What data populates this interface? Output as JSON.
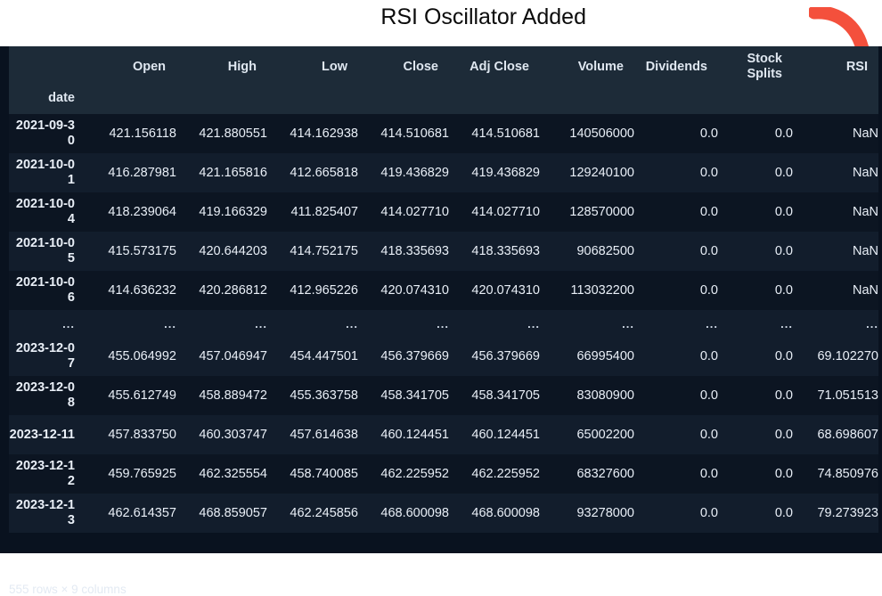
{
  "annotation": {
    "title": "RSI Oscillator Added",
    "arrow_color": "#f44336",
    "arrow_name": "curved-down-arrow"
  },
  "theme": {
    "page_background": "#ffffff",
    "panel_background": "#09121f",
    "header_background": "#1d2b38",
    "row_odd_background": "#0c1522",
    "row_even_background": "#121d2c",
    "text_color": "#e9eff7"
  },
  "table": {
    "index_name": "date",
    "columns": [
      "Open",
      "High",
      "Low",
      "Close",
      "Adj Close",
      "Volume",
      "Dividends",
      "Stock Splits",
      "RSI"
    ],
    "ellipsis": "...",
    "rows": [
      {
        "index": "2021-09-30",
        "cells": [
          "421.156118",
          "421.880551",
          "414.162938",
          "414.510681",
          "414.510681",
          "140506000",
          "0.0",
          "0.0",
          "NaN"
        ]
      },
      {
        "index": "2021-10-01",
        "cells": [
          "416.287981",
          "421.165816",
          "412.665818",
          "419.436829",
          "419.436829",
          "129240100",
          "0.0",
          "0.0",
          "NaN"
        ]
      },
      {
        "index": "2021-10-04",
        "cells": [
          "418.239064",
          "419.166329",
          "411.825407",
          "414.027710",
          "414.027710",
          "128570000",
          "0.0",
          "0.0",
          "NaN"
        ]
      },
      {
        "index": "2021-10-05",
        "cells": [
          "415.573175",
          "420.644203",
          "414.752175",
          "418.335693",
          "418.335693",
          "90682500",
          "0.0",
          "0.0",
          "NaN"
        ]
      },
      {
        "index": "2021-10-06",
        "cells": [
          "414.636232",
          "420.286812",
          "412.965226",
          "420.074310",
          "420.074310",
          "113032200",
          "0.0",
          "0.0",
          "NaN"
        ]
      },
      {
        "index": "2023-12-07",
        "cells": [
          "455.064992",
          "457.046947",
          "454.447501",
          "456.379669",
          "456.379669",
          "66995400",
          "0.0",
          "0.0",
          "69.102270"
        ]
      },
      {
        "index": "2023-12-08",
        "cells": [
          "455.612749",
          "458.889472",
          "455.363758",
          "458.341705",
          "458.341705",
          "83080900",
          "0.0",
          "0.0",
          "71.051513"
        ]
      },
      {
        "index": "2023-12-11",
        "cells": [
          "457.833750",
          "460.303747",
          "457.614638",
          "460.124451",
          "460.124451",
          "65002200",
          "0.0",
          "0.0",
          "68.698607"
        ]
      },
      {
        "index": "2023-12-12",
        "cells": [
          "459.765925",
          "462.325554",
          "458.740085",
          "462.225952",
          "462.225952",
          "68327600",
          "0.0",
          "0.0",
          "74.850976"
        ]
      },
      {
        "index": "2023-12-13",
        "cells": [
          "462.614357",
          "468.859057",
          "462.245856",
          "468.600098",
          "468.600098",
          "93278000",
          "0.0",
          "0.0",
          "79.273923"
        ]
      }
    ],
    "footer": "555 rows × 9 columns"
  }
}
